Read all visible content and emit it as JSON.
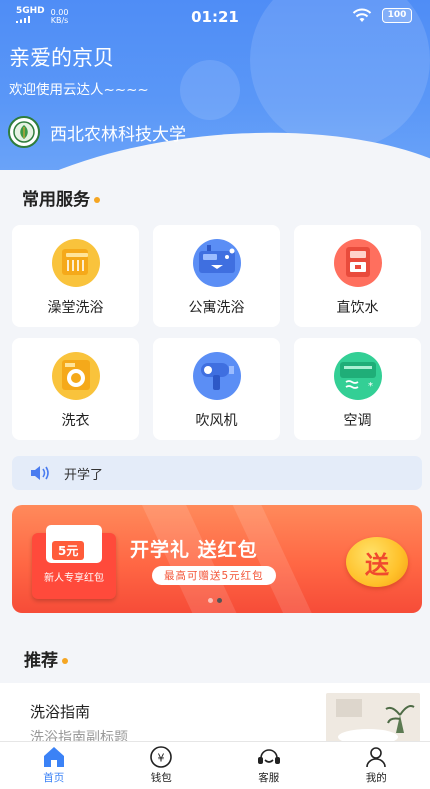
{
  "status_bar": {
    "signal": "5GHD",
    "speed_value": "0.00",
    "speed_unit": "KB/s",
    "time": "01:21",
    "battery": "100"
  },
  "header": {
    "greeting": "亲爱的京贝",
    "welcome": "欢迎使用云达人~~~~",
    "school_name": "西北农林科技大学"
  },
  "services": {
    "title": "常用服务",
    "items": [
      {
        "label": "澡堂洗浴",
        "icon": "shower-icon",
        "color": "#f5b72a"
      },
      {
        "label": "公寓洗浴",
        "icon": "water-heater-icon",
        "color": "#4a7cf0"
      },
      {
        "label": "直饮水",
        "icon": "water-dispenser-icon",
        "color": "#f25a4a"
      },
      {
        "label": "洗衣",
        "icon": "washing-machine-icon",
        "color": "#f5b72a"
      },
      {
        "label": "吹风机",
        "icon": "hair-dryer-icon",
        "color": "#4a7cf0"
      },
      {
        "label": "空调",
        "icon": "air-conditioner-icon",
        "color": "#27c08a"
      }
    ]
  },
  "notice": {
    "icon": "speaker-icon",
    "text": "开学了"
  },
  "banner": {
    "title": "开学礼  送红包",
    "subtitle": "最高可赠送5元红包",
    "coupon_amount": "5元",
    "coupon_tag": "新人专享红包",
    "send_label": "送",
    "page_count": 2,
    "current_page": 2
  },
  "recommend": {
    "title": "推荐",
    "card_title": "洗浴指南",
    "card_subtitle": "洗浴指南副标题"
  },
  "tabbar": [
    {
      "label": "首页",
      "icon": "home-icon",
      "active": true
    },
    {
      "label": "钱包",
      "icon": "wallet-icon",
      "active": false
    },
    {
      "label": "客服",
      "icon": "customer-service-icon",
      "active": false
    },
    {
      "label": "我的",
      "icon": "profile-icon",
      "active": false
    }
  ],
  "colors": {
    "primary": "#3b82f6",
    "accent_dot": "#f5a623",
    "banner_red": "#ff6744"
  }
}
